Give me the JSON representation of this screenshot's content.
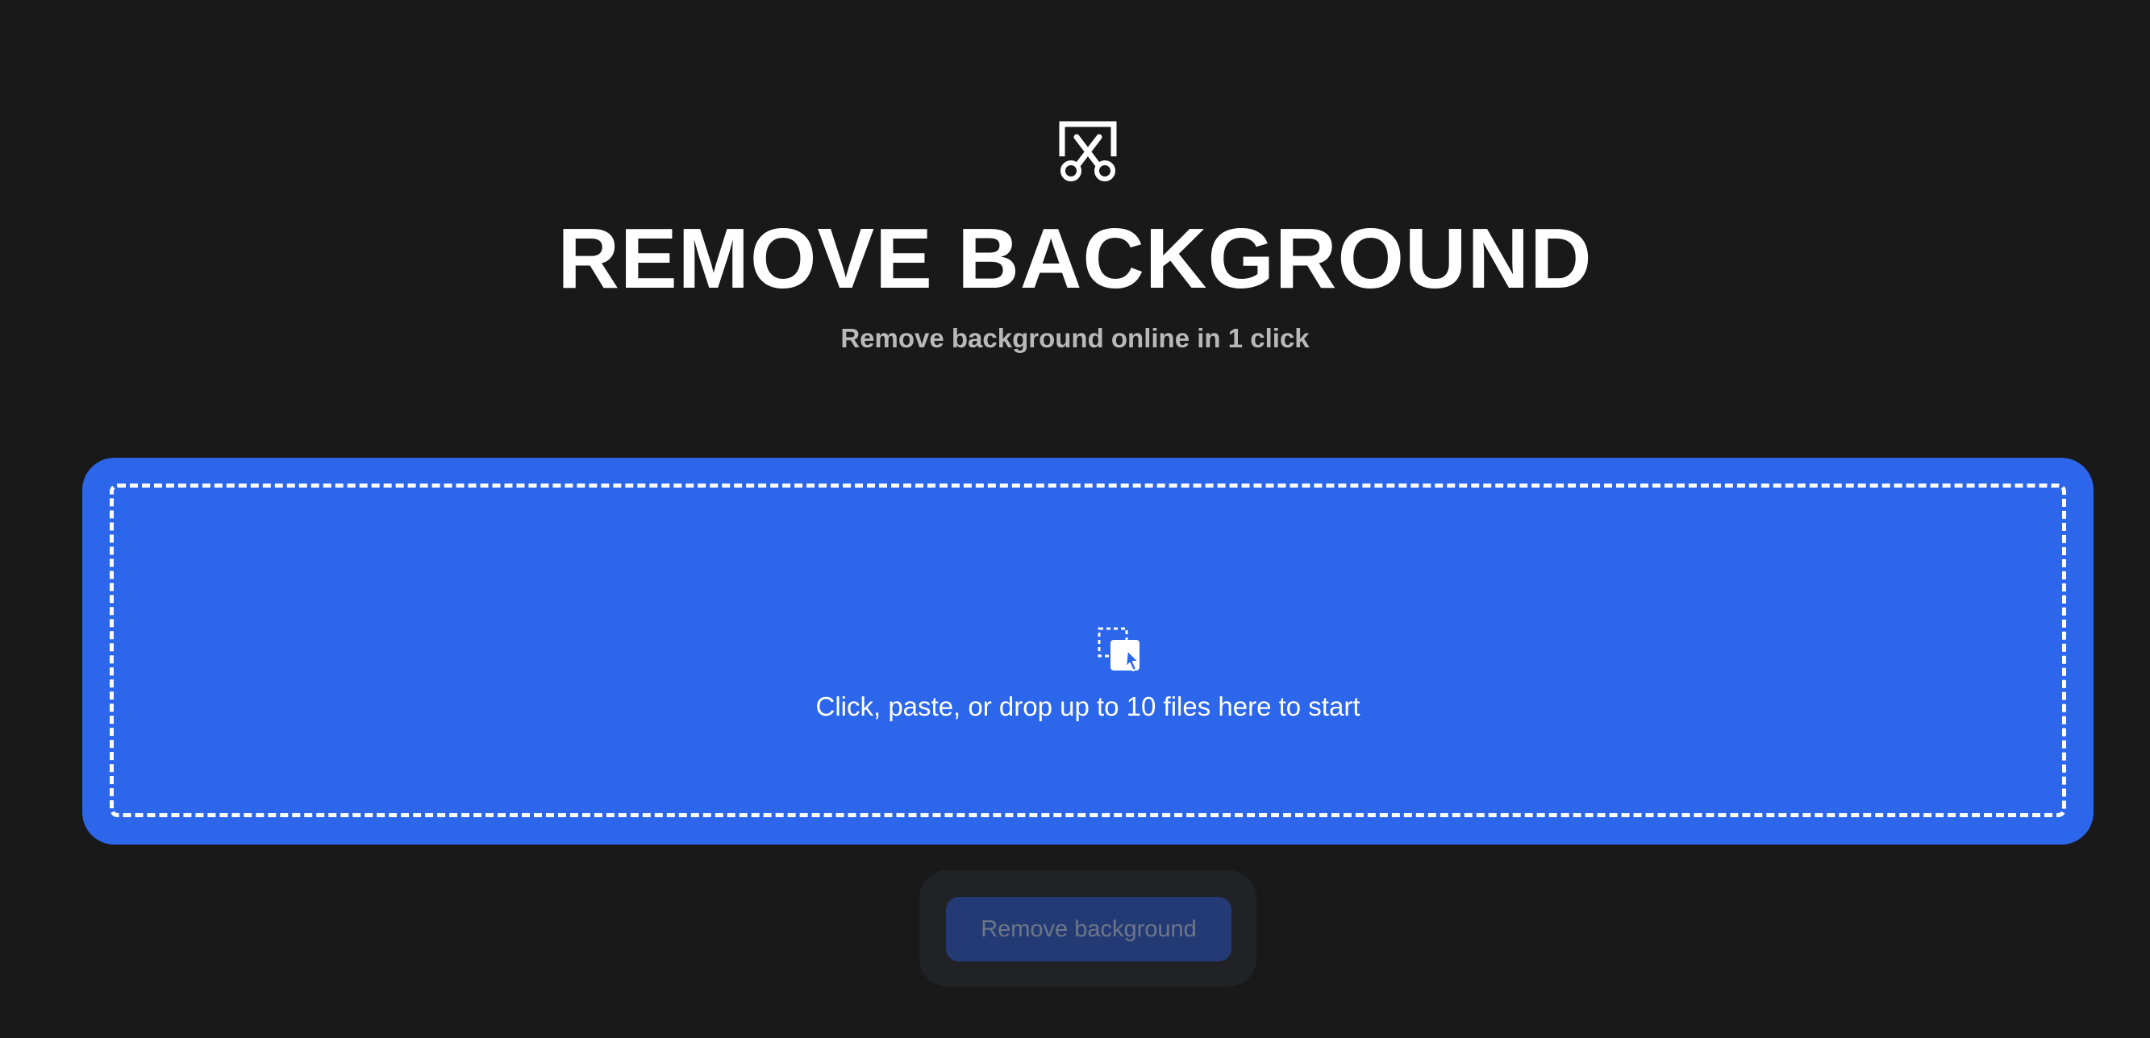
{
  "header": {
    "logo_icon": "scissors-frame-icon",
    "title": "REMOVE BACKGROUND",
    "subtitle": "Remove background online in 1 click"
  },
  "dropzone": {
    "icon": "drop-files-icon",
    "text": "Click, paste, or drop up to 10 files here to start",
    "background_color": "#2c66ea"
  },
  "action": {
    "button_label": "Remove background",
    "disabled": true
  }
}
